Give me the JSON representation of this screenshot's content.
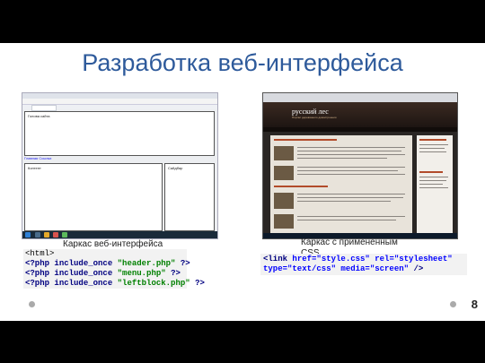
{
  "slide": {
    "title": "Разработка веб-интерфейса",
    "page_number": "8"
  },
  "left_screenshot": {
    "header_box_label": "Голова сайта",
    "menu_links": "Главная  Ссылки",
    "content_box_label": "Контент",
    "sidebar_box_label": "Сайдбар"
  },
  "right_screenshot": {
    "site_logo": "русский лес",
    "site_tagline": "Портал деревянного домостроения"
  },
  "captions": {
    "left": "Каркас веб-интерфейса",
    "right": "Каркас с примененным CSS"
  },
  "code_left": {
    "line1": "<html>",
    "lines": [
      {
        "open": "<?php",
        "fn": "include_once",
        "arg": "\"header.php\"",
        "close": "?>"
      },
      {
        "open": "<?php",
        "fn": "include_once",
        "arg": "\"menu.php\"",
        "close": "?>"
      },
      {
        "open": "<?php",
        "fn": "include_once",
        "arg": "\"leftblock.php\"",
        "close": "?>"
      }
    ]
  },
  "code_right": {
    "line1_tag": "<link",
    "line1_attr1": "href=\"style.css\"",
    "line1_attr2": "rel=\"stylesheet\"",
    "line2_attr1": "type=\"text/css\"",
    "line2_attr2": "media=\"screen\"",
    "line2_end": "/>"
  }
}
